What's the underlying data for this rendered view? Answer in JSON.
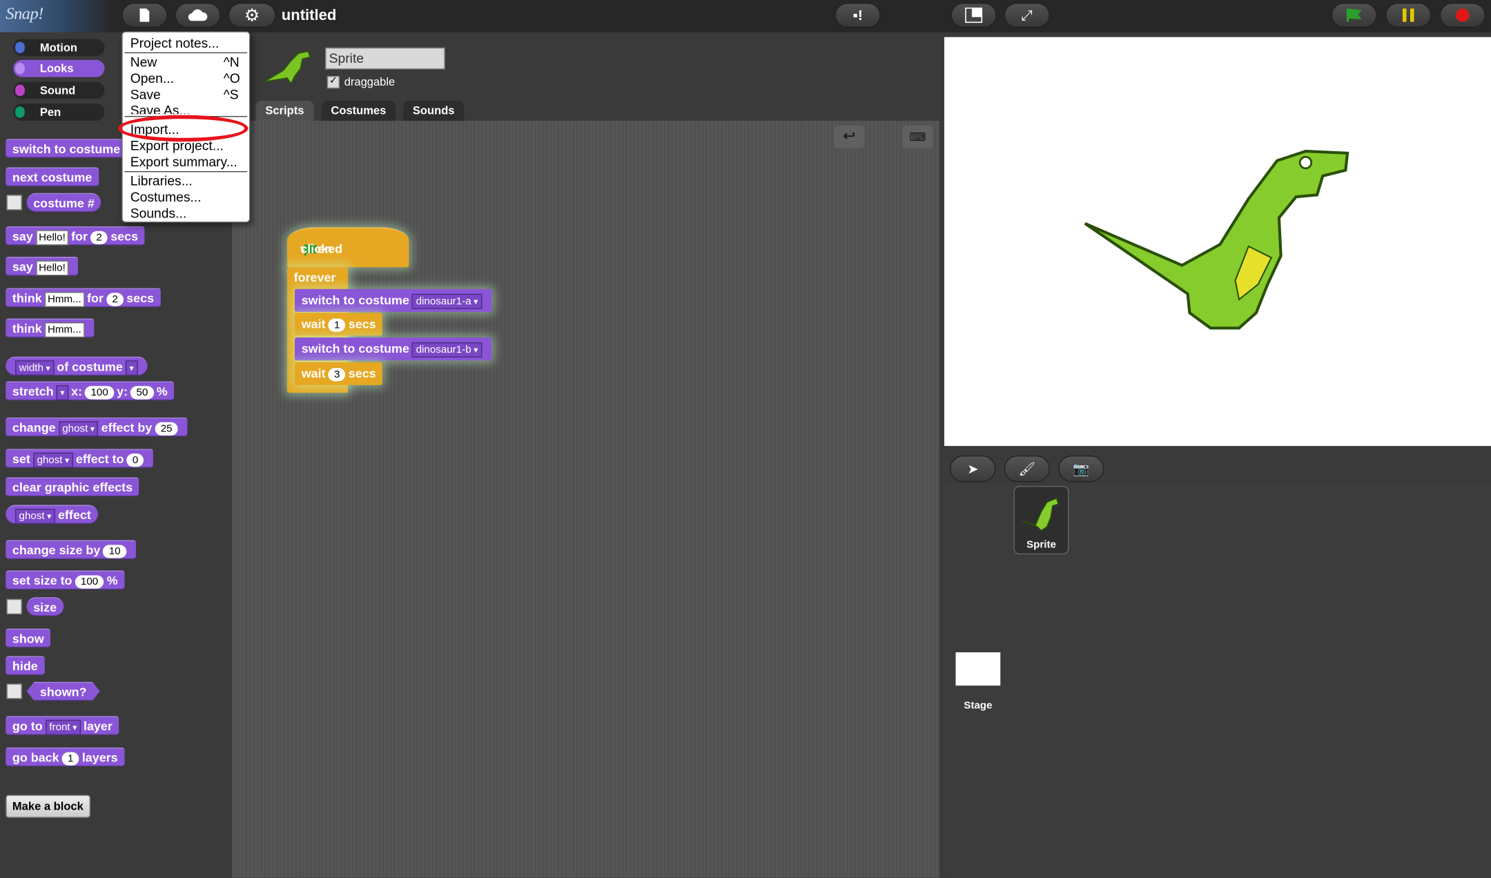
{
  "app": {
    "logo": "Snap!",
    "project_title": "untitled"
  },
  "topbar": {
    "file_icon": "file-icon",
    "cloud_icon": "cloud-icon",
    "settings_icon": "gear-icon",
    "run_controls": [
      "green-flag-icon",
      "pause-icon",
      "stop-icon"
    ]
  },
  "categories": [
    {
      "label": "Motion",
      "color": "#4a6cd4"
    },
    {
      "label": "Looks",
      "color": "#8a55d7"
    },
    {
      "label": "Sound",
      "color": "#bb42c3"
    },
    {
      "label": "Pen",
      "color": "#0e9a6c"
    }
  ],
  "palette": {
    "b1": "switch to costume",
    "b2": "next costume",
    "b3": "costume #",
    "say": "say",
    "hello": "Hello!",
    "for": "for",
    "two": "2",
    "secs": "secs",
    "think": "think",
    "hmm": "Hmm...",
    "width": "width",
    "of_costume": "of costume",
    "stretch": "stretch",
    "x": "x:",
    "hundred": "100",
    "y": "y:",
    "fifty": "50",
    "pct": "%",
    "change": "change",
    "ghost": "ghost",
    "effect_by": "effect by",
    "twentyfive": "25",
    "set": "set",
    "effect_to": "effect to",
    "zero": "0",
    "clear": "clear graphic effects",
    "effect": "effect",
    "change_size_by": "change size by",
    "ten": "10",
    "set_size_to": "set size to",
    "size": "size",
    "show": "show",
    "hide": "hide",
    "shown": "shown?",
    "go_to": "go to",
    "front": "front",
    "layer": "layer",
    "go_back": "go back",
    "one": "1",
    "layers": "layers",
    "make_block": "Make a block"
  },
  "sprite": {
    "name": "Sprite",
    "draggable_label": "draggable",
    "draggable_check": "✓"
  },
  "tabs": [
    "Scripts",
    "Costumes",
    "Sounds"
  ],
  "script": {
    "when": "when",
    "clicked": "clicked",
    "forever": "forever",
    "switch_to_costume": "switch to costume",
    "costume_a": "dinosaur1-a",
    "costume_b": "dinosaur1-b",
    "wait": "wait",
    "secs": "secs",
    "wait1": "1",
    "wait2": "3"
  },
  "corral": {
    "sprite_label": "Sprite",
    "stage_label": "Stage"
  },
  "file_menu": {
    "items": [
      {
        "label": "Project notes..."
      },
      {
        "label": "New",
        "shortcut": "^N"
      },
      {
        "label": "Open...",
        "shortcut": "^O"
      },
      {
        "label": "Save",
        "shortcut": "^S"
      },
      {
        "label": "Save As..."
      },
      {
        "label": "Import..."
      },
      {
        "label": "Export project..."
      },
      {
        "label": "Export summary..."
      },
      {
        "label": "Libraries..."
      },
      {
        "label": "Costumes..."
      },
      {
        "label": "Sounds..."
      }
    ],
    "highlighted_item": "Import..."
  }
}
